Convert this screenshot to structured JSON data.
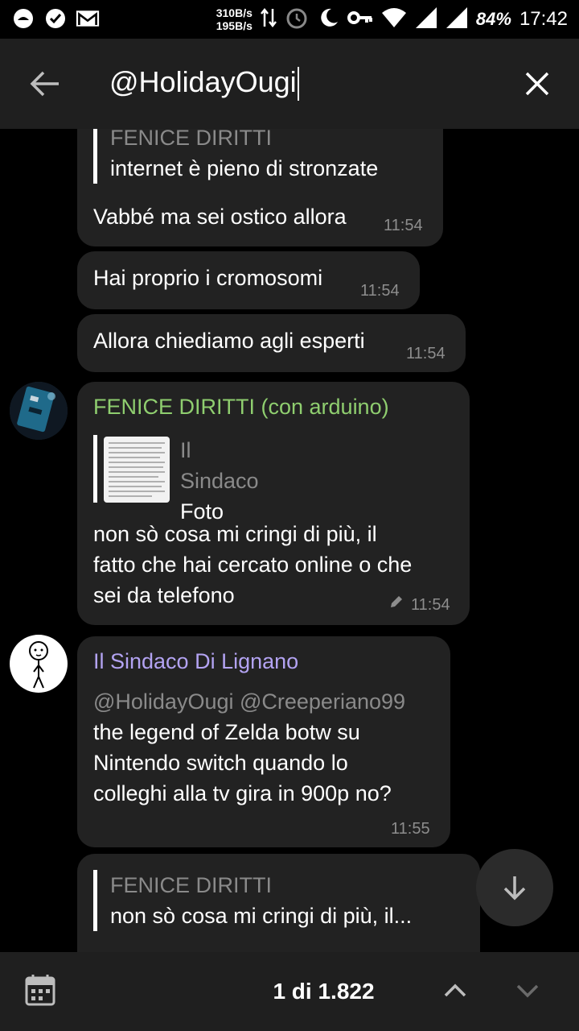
{
  "status_bar": {
    "net_up": "310B/s",
    "net_down": "195B/s",
    "battery": "84%",
    "time": "17:42",
    "icons": [
      "app-icon",
      "check-icon",
      "gmail-icon",
      "data-arrows-icon",
      "alarm-icon",
      "moon-icon",
      "key-icon",
      "wifi-icon",
      "signal-icon",
      "signal-icon"
    ]
  },
  "search": {
    "query": "@HolidayOugi",
    "back_icon": "arrow-left-icon",
    "close_icon": "close-icon"
  },
  "messages": [
    {
      "reply_name": "FENICE DIRITTI",
      "reply_text": "internet è pieno di stronzate",
      "text": "Vabbé ma sei ostico allora",
      "time": "11:54"
    },
    {
      "text": "Hai proprio i cromosomi",
      "time": "11:54"
    },
    {
      "text": "Allora chiediamo agli esperti",
      "time": "11:54"
    },
    {
      "sender": "FENICE DIRITTI (con arduino)",
      "sender_color": "#8fce6f",
      "reply_name": "Il Sindaco",
      "reply_text": "Foto",
      "text_lines": [
        "non sò cosa mi cringi di più, il",
        "fatto che hai cercato online o che",
        "sei da telefono"
      ],
      "time": "11:54",
      "edited_icon": "pencil-icon"
    },
    {
      "sender": "Il Sindaco Di Lignano",
      "sender_color": "#b3a3f2",
      "mention_line": "@HolidayOugi @Creeperiano99",
      "text_lines": [
        "the legend of Zelda botw su",
        "Nintendo switch quando lo",
        "colleghi alla tv gira in 900p no?"
      ],
      "time": "11:55"
    },
    {
      "reply_name": "FENICE DIRITTI",
      "reply_text": "non sò cosa mi cringi di più, il..."
    }
  ],
  "scroll_down_icon": "arrow-down-icon",
  "bottom_bar": {
    "counter": "1 di 1.822",
    "calendar_icon": "calendar-icon",
    "up_icon": "chevron-up-icon",
    "down_icon": "chevron-down-icon"
  }
}
